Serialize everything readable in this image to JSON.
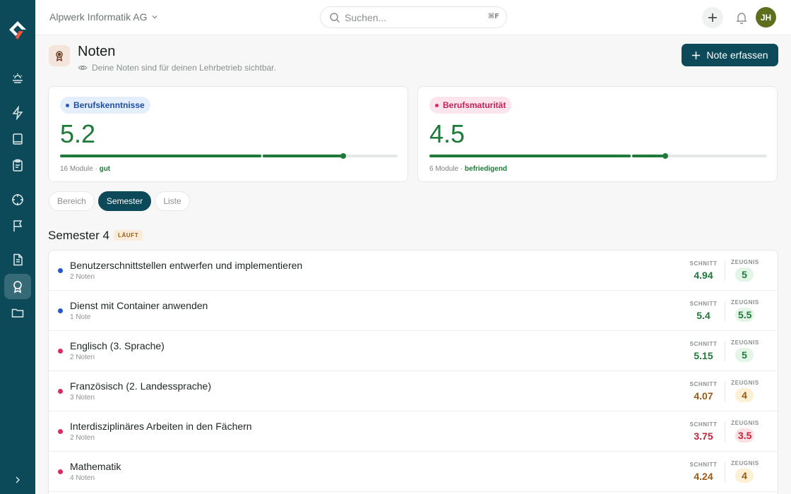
{
  "topbar": {
    "org": "Alpwerk Informatik AG",
    "search_placeholder": "Suchen...",
    "search_shortcut": "⌘F",
    "avatar_initials": "JH"
  },
  "page": {
    "title": "Noten",
    "subtitle": "Deine Noten sind für deinen Lehrbetrieb sichtbar.",
    "primary_action": "Note erfassen"
  },
  "cards": [
    {
      "label": "Berufskenntnisse",
      "value": "5.2",
      "modules": "16 Module",
      "sep": " · ",
      "quality": "gut",
      "accent": "#2458c9"
    },
    {
      "label": "Berufsmaturität",
      "value": "4.5",
      "modules": "6 Module",
      "sep": " · ",
      "quality": "befriedigend",
      "accent": "#d62e63"
    }
  ],
  "view_tabs": [
    "Bereich",
    "Semester",
    "Liste"
  ],
  "active_tab": "Semester",
  "semester": {
    "title": "Semester 4",
    "badge": "LÄUFT",
    "labels": {
      "avg": "SCHNITT",
      "report": "ZEUGNIS"
    },
    "rows": [
      {
        "name": "Benutzerschnittstellen entwerfen und implementieren",
        "count": "2 Noten",
        "avg": "4.94",
        "report": "5",
        "color": "blue",
        "level": "green"
      },
      {
        "name": "Dienst mit Container anwenden",
        "count": "1 Note",
        "avg": "5.4",
        "report": "5.5",
        "color": "blue",
        "level": "green"
      },
      {
        "name": "Englisch (3. Sprache)",
        "count": "2 Noten",
        "avg": "5.15",
        "report": "5",
        "color": "pink",
        "level": "green"
      },
      {
        "name": "Französisch (2. Landessprache)",
        "count": "3 Noten",
        "avg": "4.07",
        "report": "4",
        "color": "pink",
        "level": "amber"
      },
      {
        "name": "Interdisziplinäres Arbeiten in den Fächern",
        "count": "2 Noten",
        "avg": "3.75",
        "report": "3.5",
        "color": "pink",
        "level": "red"
      },
      {
        "name": "Mathematik",
        "count": "4 Noten",
        "avg": "4.24",
        "report": "4",
        "color": "pink",
        "level": "amber"
      }
    ]
  },
  "colors": {
    "brand": "#0c4a5a",
    "good": "#1f7a3a",
    "warn": "#9a5a16",
    "bad": "#c02439",
    "blue_dot": "#2458c9",
    "pink_dot": "#d62e63"
  }
}
